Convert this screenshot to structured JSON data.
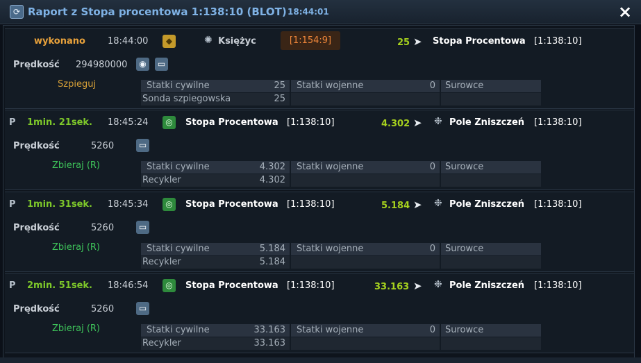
{
  "window": {
    "title": "Raport z Stopa procentowa 1:138:10 (BLOT)",
    "time": "18:44:01",
    "close_label": "×"
  },
  "icons": {
    "title_icon": "refresh-icon",
    "close": "close-icon",
    "chat": "chat-bubble-icon",
    "eye": "eye-icon",
    "moon": "moon-icon",
    "debris": "debris-field-icon",
    "planet": "planet-icon",
    "arrow": "fleet-arrow-icon"
  },
  "colors": {
    "accent_blue": "#7fb2e5",
    "status_yellow": "#e9a23b",
    "green": "#7ec82a",
    "mission_green": "#3ec45a",
    "orange": "#f0873a"
  },
  "entries": [
    {
      "prefix": "",
      "status": "wykonano",
      "time": "18:44:00",
      "origin_name": "Księżyc",
      "origin_badge": "[1:154:9]",
      "count": "25",
      "target_name": "Stopa Procentowa",
      "target_coords": "[1:138:10]",
      "speed_label": "Prędkość",
      "speed_value": "294980000",
      "mission": "Szpieguj",
      "stats": {
        "civil_label": "Statki cywilne",
        "civil_value": "25",
        "war_label": "Statki wojenne",
        "war_value": "0",
        "resources_label": "Surowce",
        "ship_label": "Sonda szpiegowska",
        "ship_value": "25"
      }
    },
    {
      "prefix": "P",
      "status": "1min. 21sek.",
      "time": "18:45:24",
      "origin_name": "Stopa Procentowa",
      "origin_coords": "[1:138:10]",
      "count": "4.302",
      "target_name": "Pole Zniszczeń",
      "target_coords": "[1:138:10]",
      "speed_label": "Prędkość",
      "speed_value": "5260",
      "mission": "Zbieraj (R)",
      "stats": {
        "civil_label": "Statki cywilne",
        "civil_value": "4.302",
        "war_label": "Statki wojenne",
        "war_value": "0",
        "resources_label": "Surowce",
        "ship_label": "Recykler",
        "ship_value": "4.302"
      }
    },
    {
      "prefix": "P",
      "status": "1min. 31sek.",
      "time": "18:45:34",
      "origin_name": "Stopa Procentowa",
      "origin_coords": "[1:138:10]",
      "count": "5.184",
      "target_name": "Pole Zniszczeń",
      "target_coords": "[1:138:10]",
      "speed_label": "Prędkość",
      "speed_value": "5260",
      "mission": "Zbieraj (R)",
      "stats": {
        "civil_label": "Statki cywilne",
        "civil_value": "5.184",
        "war_label": "Statki wojenne",
        "war_value": "0",
        "resources_label": "Surowce",
        "ship_label": "Recykler",
        "ship_value": "5.184"
      }
    },
    {
      "prefix": "P",
      "status": "2min. 51sek.",
      "time": "18:46:54",
      "origin_name": "Stopa Procentowa",
      "origin_coords": "[1:138:10]",
      "count": "33.163",
      "target_name": "Pole Zniszczeń",
      "target_coords": "[1:138:10]",
      "speed_label": "Prędkość",
      "speed_value": "5260",
      "mission": "Zbieraj (R)",
      "stats": {
        "civil_label": "Statki cywilne",
        "civil_value": "33.163",
        "war_label": "Statki wojenne",
        "war_value": "0",
        "resources_label": "Surowce",
        "ship_label": "Recykler",
        "ship_value": "33.163"
      }
    }
  ]
}
